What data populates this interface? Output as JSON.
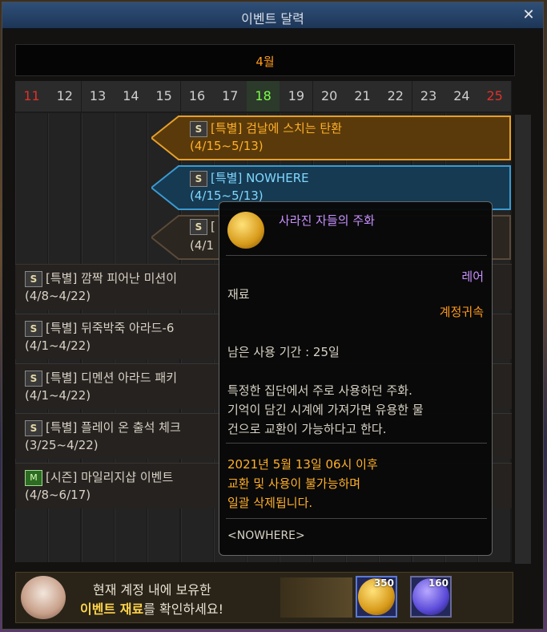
{
  "window": {
    "title": "이벤트 달력",
    "close_icon": "close-icon"
  },
  "month": "4월",
  "days": [
    {
      "label": "11",
      "color": "#e0302a"
    },
    {
      "label": "12",
      "color": "#cfcfcf"
    },
    {
      "label": "13",
      "color": "#cfcfcf"
    },
    {
      "label": "14",
      "color": "#cfcfcf"
    },
    {
      "label": "15",
      "color": "#cfcfcf"
    },
    {
      "label": "16",
      "color": "#cfcfcf"
    },
    {
      "label": "17",
      "color": "#cfcfcf"
    },
    {
      "label": "18",
      "color": "#7cff4a"
    },
    {
      "label": "19",
      "color": "#cfcfcf"
    },
    {
      "label": "20",
      "color": "#cfcfcf"
    },
    {
      "label": "21",
      "color": "#cfcfcf"
    },
    {
      "label": "22",
      "color": "#cfcfcf"
    },
    {
      "label": "23",
      "color": "#cfcfcf"
    },
    {
      "label": "24",
      "color": "#cfcfcf"
    },
    {
      "label": "25",
      "color": "#e0302a"
    }
  ],
  "banners": [
    {
      "title": "[특별] 검날에 스치는 탄환",
      "dates": "(4/15~5/13)",
      "color": "#ffb02a"
    },
    {
      "title": "[특별] NOWHERE",
      "dates": "(4/15~5/13)",
      "color": "#7fd7ff"
    },
    {
      "title": "[",
      "dates": "(4/1",
      "color": "#d8d2c4"
    }
  ],
  "events": [
    {
      "title": "[특별] 깜짝 피어난 미션이",
      "dates": "(4/8~4/22)",
      "icon": "S"
    },
    {
      "title": "[특별] 뒤죽박죽 아라드-6",
      "dates": "(4/1~4/22)",
      "icon": "S"
    },
    {
      "title": "[특별] 디멘션 아라드 패키",
      "dates": "(4/1~4/22)",
      "icon": "S"
    },
    {
      "title": "[특별] 플레이 온 출석 체크",
      "dates": "(3/25~4/22)",
      "icon": "S"
    },
    {
      "title": "[시즌] 마일리지샵 이벤트",
      "dates": "(4/8~6/17)",
      "icon": "M"
    }
  ],
  "tooltip": {
    "name": "사라진 자들의 주화",
    "rarity": "레어",
    "type": "재료",
    "binding": "계정귀속",
    "remaining": "남은 사용 기간 : 25일",
    "desc1": "특정한 집단에서 주로 사용하던 주화.",
    "desc2": "기억이 담긴 시계에 가져가면 유용한 물",
    "desc3": "건으로 교환이 가능하다고 한다.",
    "exp1": "2021년 5월 13일 06시 이후",
    "exp2": "교환 및 사용이 불가능하며",
    "exp3": "일괄 삭제됩니다.",
    "source": "<NOWHERE>",
    "name_color": "#c890ff",
    "rarity_color": "#c890ff",
    "binding_color": "#ff9a1a"
  },
  "bottom": {
    "line1": "현재 계정 내에 보유한",
    "line2_bold": "이벤트 재료",
    "line2_rest": "를 확인하세요!",
    "item1_count": "350",
    "item2_count": "160"
  }
}
